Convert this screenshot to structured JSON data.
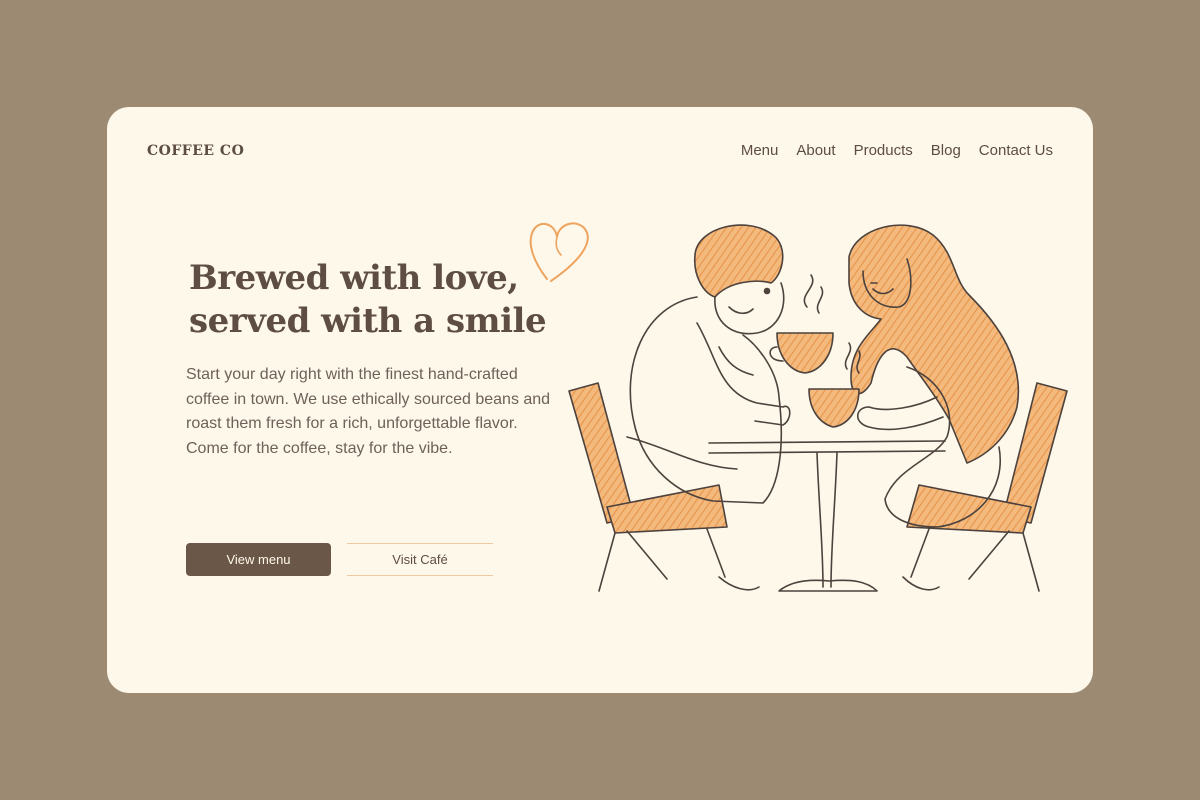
{
  "brand": {
    "name": "COFFEE CO"
  },
  "nav": {
    "items": [
      {
        "label": "Menu"
      },
      {
        "label": "About"
      },
      {
        "label": "Products"
      },
      {
        "label": "Blog"
      },
      {
        "label": "Contact Us"
      }
    ]
  },
  "hero": {
    "headline_line1": "Brewed with love,",
    "headline_line2": "served with a smile",
    "description": "Start your day right with the finest hand-crafted coffee in town. We use ethically sourced beans and roast them fresh for a rich, unforgettable flavor. Come for the coffee, stay for the vibe.",
    "primary_button": "View menu",
    "secondary_button": "Visit Café"
  },
  "colors": {
    "page_background": "#9c8a72",
    "card_background": "#fdf8ea",
    "text_brown": "#5e4d43",
    "button_brown": "#6b5748",
    "accent_orange": "#eea45e"
  },
  "icons": {
    "decoration": "heart-outline-icon",
    "illustration": "couple-drinking-coffee-illustration"
  }
}
